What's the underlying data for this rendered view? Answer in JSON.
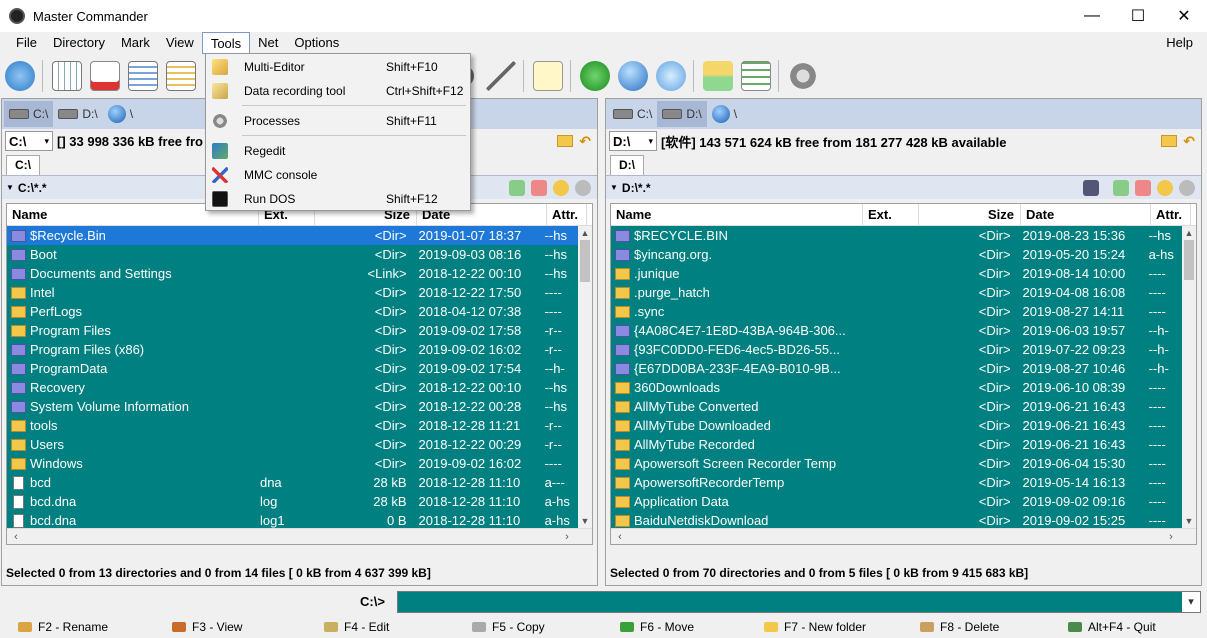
{
  "window": {
    "title": "Master Commander",
    "minimize": "—",
    "maximize": "☐",
    "close": "✕"
  },
  "menubar": {
    "items": [
      "File",
      "Directory",
      "Mark",
      "View",
      "Tools",
      "Net",
      "Options"
    ],
    "help": "Help"
  },
  "tools_menu": {
    "items": [
      {
        "label": "Multi-Editor",
        "shortcut": "Shift+F10",
        "icon": "pencil-icon"
      },
      {
        "label": "Data recording tool",
        "shortcut": "Ctrl+Shift+F12",
        "icon": "recording-icon"
      },
      {
        "label": "Processes",
        "shortcut": "Shift+F11",
        "icon": "gear-icon"
      },
      {
        "label": "Regedit",
        "shortcut": "",
        "icon": "registry-icon"
      },
      {
        "label": "MMC console",
        "shortcut": "",
        "icon": "tools-icon"
      },
      {
        "label": "Run DOS",
        "shortcut": "Shift+F12",
        "icon": "console-icon"
      }
    ]
  },
  "left_panel": {
    "drives": [
      "C:\\",
      "D:\\",
      "\\"
    ],
    "drive_select": "C:\\",
    "free_info": "[] 33 998 336 kB free fro",
    "tab": "C:\\",
    "path": "C:\\*.*",
    "columns": {
      "name": "Name",
      "ext": "Ext.",
      "size": "Size",
      "date": "Date",
      "attr": "Attr."
    },
    "rows": [
      {
        "name": "$Recycle.Bin",
        "ext": "",
        "size": "<Dir>",
        "date": "2019-01-07 18:37",
        "attr": "--hs",
        "type": "sys"
      },
      {
        "name": "Boot",
        "ext": "",
        "size": "<Dir>",
        "date": "2019-09-03 08:16",
        "attr": "--hs",
        "type": "sys"
      },
      {
        "name": "Documents and Settings",
        "ext": "",
        "size": "<Link>",
        "date": "2018-12-22 00:10",
        "attr": "--hs",
        "type": "sys"
      },
      {
        "name": "Intel",
        "ext": "",
        "size": "<Dir>",
        "date": "2018-12-22 17:50",
        "attr": "----",
        "type": "dir"
      },
      {
        "name": "PerfLogs",
        "ext": "",
        "size": "<Dir>",
        "date": "2018-04-12 07:38",
        "attr": "----",
        "type": "dir"
      },
      {
        "name": "Program Files",
        "ext": "",
        "size": "<Dir>",
        "date": "2019-09-02 17:58",
        "attr": "-r--",
        "type": "dir"
      },
      {
        "name": "Program Files (x86)",
        "ext": "",
        "size": "<Dir>",
        "date": "2019-09-02 16:02",
        "attr": "-r--",
        "type": "sys"
      },
      {
        "name": "ProgramData",
        "ext": "",
        "size": "<Dir>",
        "date": "2019-09-02 17:54",
        "attr": "--h-",
        "type": "sys"
      },
      {
        "name": "Recovery",
        "ext": "",
        "size": "<Dir>",
        "date": "2018-12-22 00:10",
        "attr": "--hs",
        "type": "sys"
      },
      {
        "name": "System Volume Information",
        "ext": "",
        "size": "<Dir>",
        "date": "2018-12-22 00:28",
        "attr": "--hs",
        "type": "sys"
      },
      {
        "name": "tools",
        "ext": "",
        "size": "<Dir>",
        "date": "2018-12-28 11:21",
        "attr": "-r--",
        "type": "dir"
      },
      {
        "name": "Users",
        "ext": "",
        "size": "<Dir>",
        "date": "2018-12-22 00:29",
        "attr": "-r--",
        "type": "dir"
      },
      {
        "name": "Windows",
        "ext": "",
        "size": "<Dir>",
        "date": "2019-09-02 16:02",
        "attr": "----",
        "type": "dir"
      },
      {
        "name": "bcd",
        "ext": "dna",
        "size": "28 kB",
        "date": "2018-12-28 11:10",
        "attr": "a---",
        "type": "file"
      },
      {
        "name": "bcd.dna",
        "ext": "log",
        "size": "28 kB",
        "date": "2018-12-28 11:10",
        "attr": "a-hs",
        "type": "file"
      },
      {
        "name": "bcd.dna",
        "ext": "log1",
        "size": "0 B",
        "date": "2018-12-28 11:10",
        "attr": "a-hs",
        "type": "file"
      }
    ],
    "status": "Selected 0 from 13 directories and 0 from 14 files [ 0 kB from 4 637 399 kB]"
  },
  "right_panel": {
    "drives": [
      "C:\\",
      "D:\\",
      "\\"
    ],
    "drive_select": "D:\\",
    "free_info": "[软件] 143 571 624 kB free from 181 277 428 kB available",
    "tab": "D:\\",
    "path": "D:\\*.*",
    "columns": {
      "name": "Name",
      "ext": "Ext.",
      "size": "Size",
      "date": "Date",
      "attr": "Attr."
    },
    "rows": [
      {
        "name": "$RECYCLE.BIN",
        "size": "<Dir>",
        "date": "2019-08-23 15:36",
        "attr": "--hs",
        "type": "sys"
      },
      {
        "name": "$yincang.org.",
        "size": "<Dir>",
        "date": "2019-05-20 15:24",
        "attr": "a-hs",
        "type": "sys"
      },
      {
        "name": ".junique",
        "size": "<Dir>",
        "date": "2019-08-14 10:00",
        "attr": "----",
        "type": "dir"
      },
      {
        "name": ".purge_hatch",
        "size": "<Dir>",
        "date": "2019-04-08 16:08",
        "attr": "----",
        "type": "dir"
      },
      {
        "name": ".sync",
        "size": "<Dir>",
        "date": "2019-08-27 14:11",
        "attr": "----",
        "type": "dir"
      },
      {
        "name": "{4A08C4E7-1E8D-43BA-964B-306...",
        "size": "<Dir>",
        "date": "2019-06-03 19:57",
        "attr": "--h-",
        "type": "sys"
      },
      {
        "name": "{93FC0DD0-FED6-4ec5-BD26-55...",
        "size": "<Dir>",
        "date": "2019-07-22 09:23",
        "attr": "--h-",
        "type": "sys"
      },
      {
        "name": "{E67DD0BA-233F-4EA9-B010-9B...",
        "size": "<Dir>",
        "date": "2019-08-27 10:46",
        "attr": "--h-",
        "type": "sys"
      },
      {
        "name": "360Downloads",
        "size": "<Dir>",
        "date": "2019-06-10 08:39",
        "attr": "----",
        "type": "dir"
      },
      {
        "name": "AllMyTube Converted",
        "size": "<Dir>",
        "date": "2019-06-21 16:43",
        "attr": "----",
        "type": "dir"
      },
      {
        "name": "AllMyTube Downloaded",
        "size": "<Dir>",
        "date": "2019-06-21 16:43",
        "attr": "----",
        "type": "dir"
      },
      {
        "name": "AllMyTube Recorded",
        "size": "<Dir>",
        "date": "2019-06-21 16:43",
        "attr": "----",
        "type": "dir"
      },
      {
        "name": "Apowersoft Screen Recorder Temp",
        "size": "<Dir>",
        "date": "2019-06-04 15:30",
        "attr": "----",
        "type": "dir"
      },
      {
        "name": "ApowersoftRecorderTemp",
        "size": "<Dir>",
        "date": "2019-05-14 16:13",
        "attr": "----",
        "type": "dir"
      },
      {
        "name": "Application Data",
        "size": "<Dir>",
        "date": "2019-09-02 09:16",
        "attr": "----",
        "type": "dir"
      },
      {
        "name": "BaiduNetdiskDownload",
        "size": "<Dir>",
        "date": "2019-09-02 15:25",
        "attr": "----",
        "type": "dir"
      }
    ],
    "status": "Selected 0 from 70 directories and 0 from 5 files [ 0 kB from 9 415 683 kB]"
  },
  "command_line": {
    "prompt": "C:\\>",
    "value": ""
  },
  "function_keys": [
    {
      "label": "F2 - Rename",
      "icon": "pencil-icon"
    },
    {
      "label": "F3 - View",
      "icon": "view-icon"
    },
    {
      "label": "F4 - Edit",
      "icon": "edit-icon"
    },
    {
      "label": "F5 - Copy",
      "icon": "copy-icon"
    },
    {
      "label": "F6 - Move",
      "icon": "move-icon"
    },
    {
      "label": "F7 - New folder",
      "icon": "new-folder-icon"
    },
    {
      "label": "F8 - Delete",
      "icon": "delete-icon"
    },
    {
      "label": "Alt+F4 - Quit",
      "icon": "quit-icon"
    }
  ],
  "colors": {
    "teal_row": "#008080",
    "selected_row": "#1e78d7",
    "drivebar": "#c8d4e8"
  }
}
